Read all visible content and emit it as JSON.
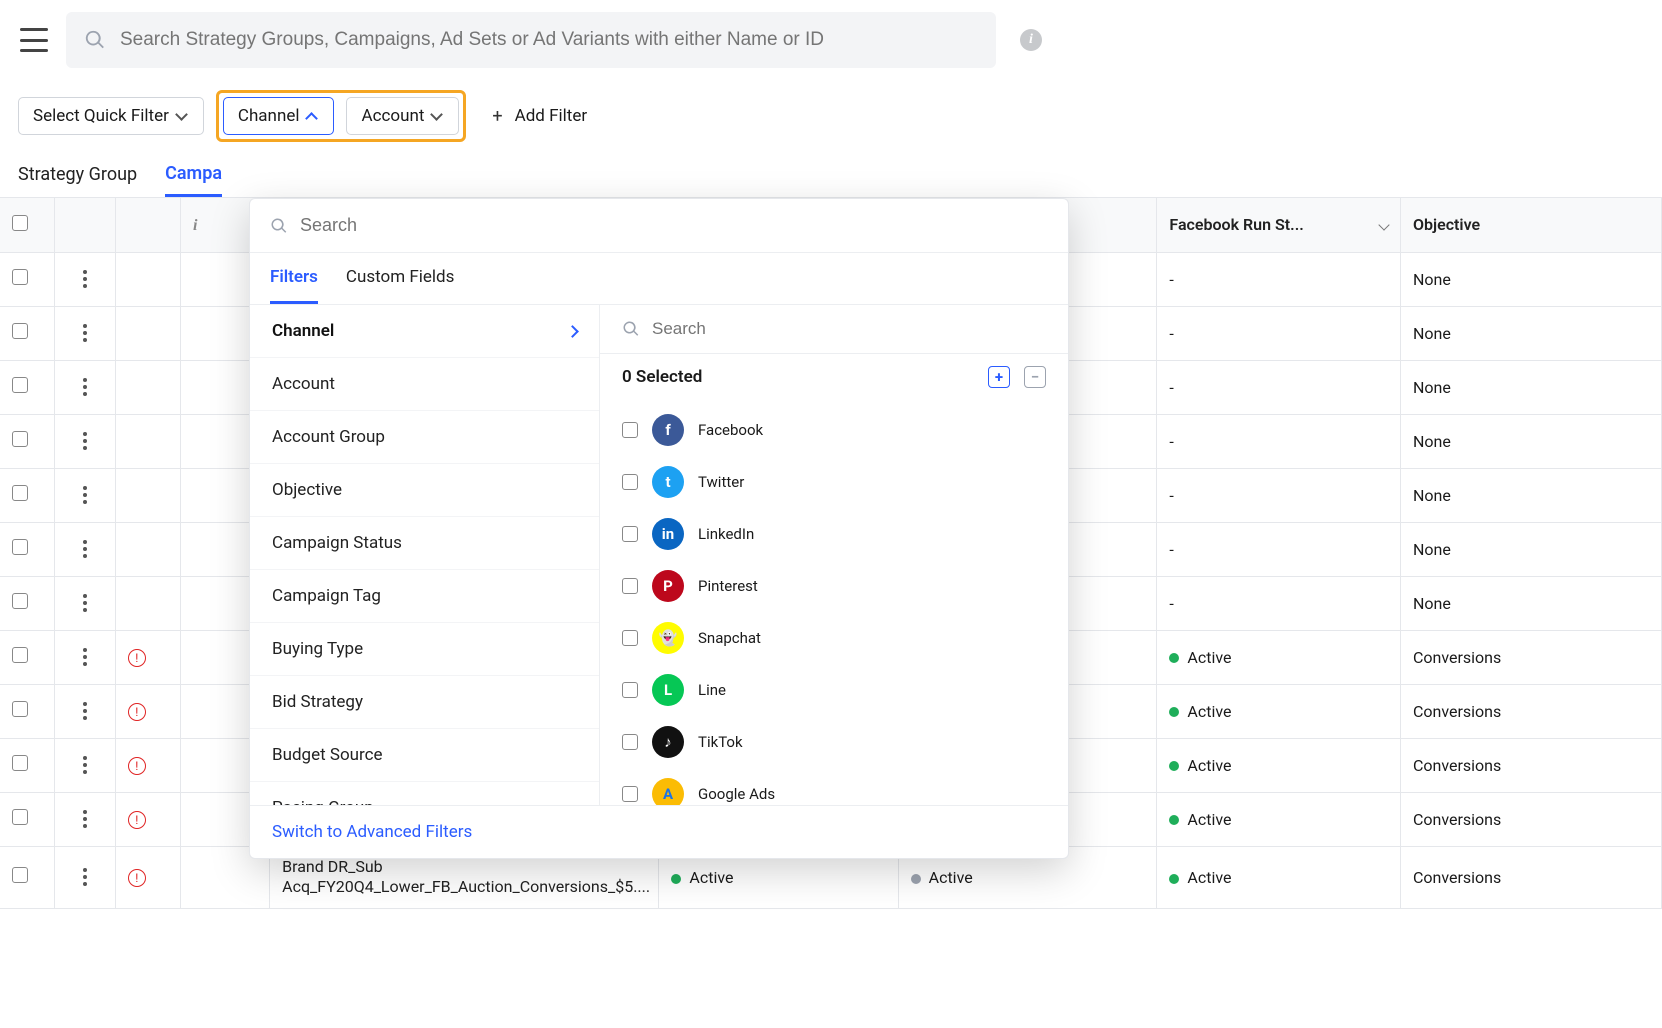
{
  "search": {
    "placeholder": "Search Strategy Groups, Campaigns, Ad Sets or Ad Variants with either Name or ID"
  },
  "filterbar": {
    "quick_filter": "Select Quick Filter",
    "channel": "Channel",
    "account": "Account",
    "add_filter": "Add Filter"
  },
  "main_tabs": {
    "strategy_group": "Strategy Group",
    "campaign": "Campa"
  },
  "table": {
    "headers": {
      "fb_run_status": "Facebook Run St...",
      "objective": "Objective"
    },
    "rows": [
      {
        "campaign": "",
        "status1": "",
        "status2": "",
        "fb_run": "-",
        "objective": "None",
        "err": false
      },
      {
        "campaign": "",
        "status1": "",
        "status2": "",
        "fb_run": "-",
        "objective": "None",
        "err": false
      },
      {
        "campaign": "",
        "status1": "",
        "status2": "",
        "fb_run": "-",
        "objective": "None",
        "err": false
      },
      {
        "campaign": "",
        "status1": "",
        "status2": "",
        "fb_run": "-",
        "objective": "None",
        "err": false
      },
      {
        "campaign": "",
        "status1": "",
        "status2": "",
        "fb_run": "-",
        "objective": "None",
        "err": false
      },
      {
        "campaign": "",
        "status1": "",
        "status2": "",
        "fb_run": "-",
        "objective": "None",
        "err": false
      },
      {
        "campaign": "",
        "status1": "",
        "status2": "",
        "fb_run": "-",
        "objective": "None",
        "err": false
      },
      {
        "campaign": "",
        "status1": "",
        "status2": "",
        "fb_run": "Active",
        "fb_dot": "green",
        "objective": "Conversions",
        "err": true
      },
      {
        "campaign": "",
        "status1": "",
        "status2": "",
        "fb_run": "Active",
        "fb_dot": "green",
        "objective": "Conversions",
        "err": true
      },
      {
        "campaign": "",
        "status1": "",
        "status2": "",
        "fb_run": "Active",
        "fb_dot": "green",
        "objective": "Conversions",
        "err": true
      },
      {
        "campaign": "",
        "status1": "",
        "status2": "",
        "fb_run": "Active",
        "fb_dot": "green",
        "objective": "Conversions",
        "err": true
      },
      {
        "campaign": "Brand DR_Sub Acq_FY20Q4_Lower_FB_Auction_Conversions_$5....",
        "status1": "Active",
        "dot1": "green",
        "status2": "Active",
        "dot2": "gray",
        "fb_run": "Active",
        "fb_dot": "green",
        "objective": "Conversions",
        "err": true
      }
    ]
  },
  "dropdown": {
    "search_placeholder": "Search",
    "tabs": {
      "filters": "Filters",
      "custom_fields": "Custom Fields"
    },
    "categories": [
      "Channel",
      "Account",
      "Account Group",
      "Objective",
      "Campaign Status",
      "Campaign Tag",
      "Buying Type",
      "Bid Strategy",
      "Budget Source",
      "Pacing Group"
    ],
    "right_search_placeholder": "Search",
    "selected_count": "0 Selected",
    "options": [
      {
        "name": "Facebook",
        "icon": "facebook",
        "glyph": "f"
      },
      {
        "name": "Twitter",
        "icon": "twitter",
        "glyph": "t"
      },
      {
        "name": "LinkedIn",
        "icon": "linkedin",
        "glyph": "in"
      },
      {
        "name": "Pinterest",
        "icon": "pinterest",
        "glyph": "P"
      },
      {
        "name": "Snapchat",
        "icon": "snapchat",
        "glyph": "👻"
      },
      {
        "name": "Line",
        "icon": "line",
        "glyph": "L"
      },
      {
        "name": "TikTok",
        "icon": "tiktok",
        "glyph": "♪"
      },
      {
        "name": "Google Ads",
        "icon": "google-ads",
        "glyph": "A"
      }
    ],
    "switch_label": "Switch to Advanced Filters"
  }
}
